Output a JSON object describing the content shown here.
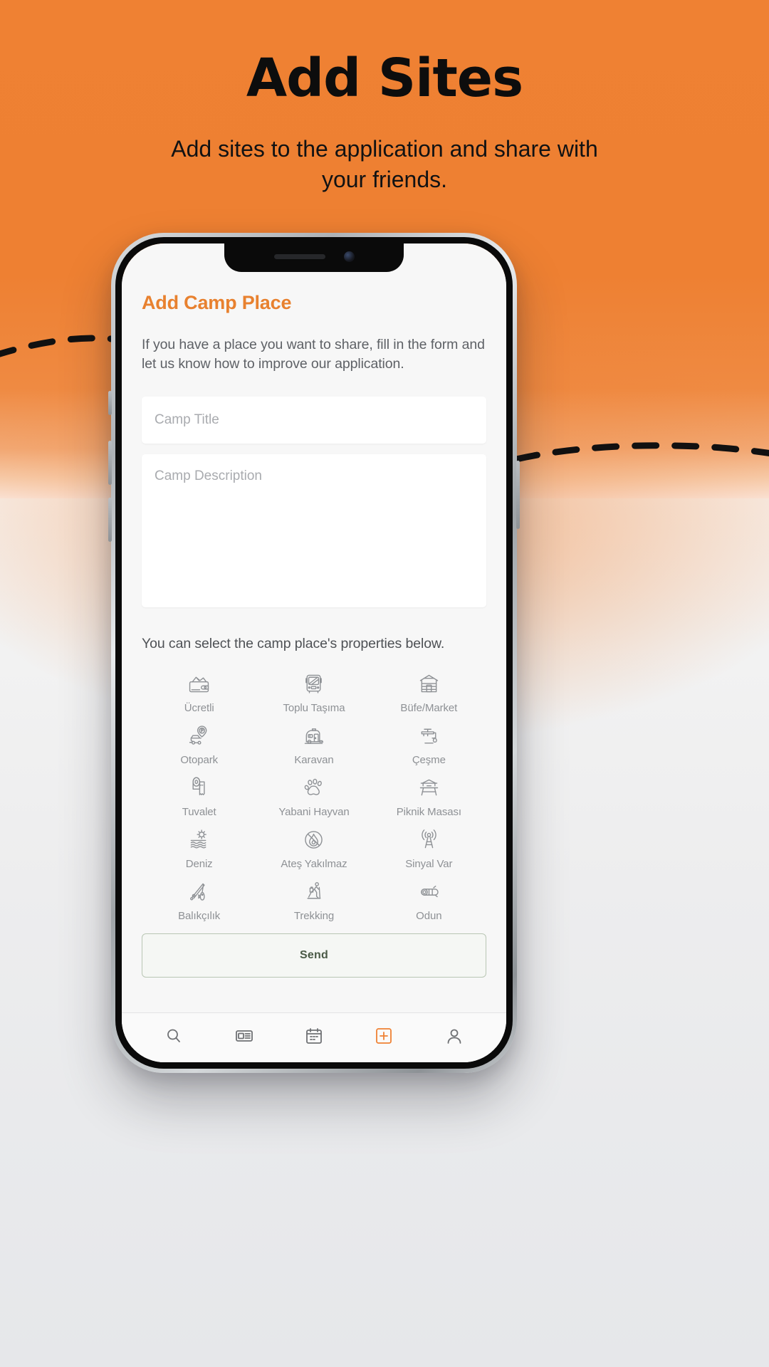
{
  "hero": {
    "title": "Add Sites",
    "subtitle": "Add sites to the application and share with your friends."
  },
  "colors": {
    "accent": "#ef8133",
    "heading": "#e8812f",
    "body_text": "#5e6166",
    "icon": "#8e9195",
    "send_border": "#b9c6b4"
  },
  "app": {
    "title": "Add Camp Place",
    "description": "If you have a place you want to share, fill in the form and let us know how to improve our application.",
    "fields": {
      "title_placeholder": "Camp Title",
      "description_placeholder": "Camp Description"
    },
    "properties_label": "You can select the camp place's properties below.",
    "properties": [
      {
        "label": "Ücretli",
        "icon": "wallet-icon"
      },
      {
        "label": "Toplu Taşıma",
        "icon": "bus-icon"
      },
      {
        "label": "Büfe/Market",
        "icon": "cabin-store-icon"
      },
      {
        "label": "Otopark",
        "icon": "parking-icon"
      },
      {
        "label": "Karavan",
        "icon": "caravan-icon"
      },
      {
        "label": "Çeşme",
        "icon": "faucet-icon"
      },
      {
        "label": "Tuvalet",
        "icon": "toilet-paper-icon"
      },
      {
        "label": "Yabani Hayvan",
        "icon": "paw-icon"
      },
      {
        "label": "Piknik Masası",
        "icon": "picnic-table-icon"
      },
      {
        "label": "Deniz",
        "icon": "sun-sea-icon"
      },
      {
        "label": "Ateş Yakılmaz",
        "icon": "no-fire-icon"
      },
      {
        "label": "Sinyal Var",
        "icon": "signal-tower-icon"
      },
      {
        "label": "Balıkçılık",
        "icon": "fishing-rod-icon"
      },
      {
        "label": "Trekking",
        "icon": "hiker-icon"
      },
      {
        "label": "Odun",
        "icon": "log-icon"
      }
    ],
    "send_label": "Send",
    "tabs": [
      {
        "name": "search",
        "icon": "search-icon",
        "active": false
      },
      {
        "name": "news",
        "icon": "news-icon",
        "active": false
      },
      {
        "name": "calendar",
        "icon": "calendar-icon",
        "active": false
      },
      {
        "name": "add",
        "icon": "plus-square-icon",
        "active": true
      },
      {
        "name": "profile",
        "icon": "person-icon",
        "active": false
      }
    ]
  }
}
